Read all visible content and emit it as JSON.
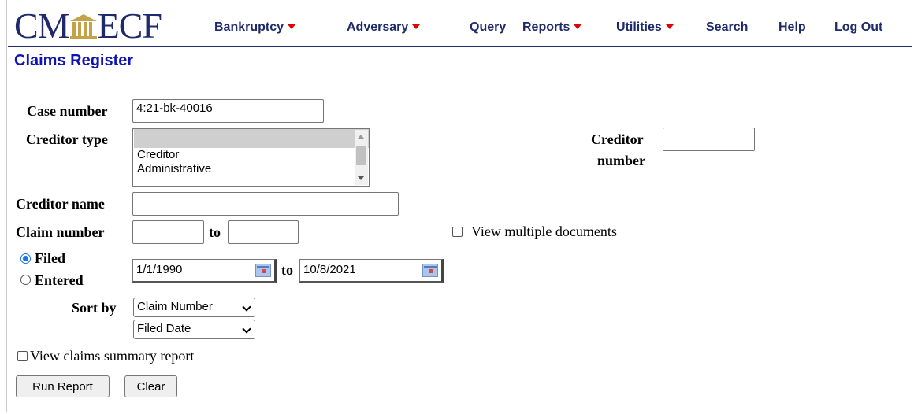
{
  "header": {
    "logo_left": "CM",
    "logo_right": "ECF",
    "nav": [
      {
        "label": "Bankruptcy",
        "dropdown": true
      },
      {
        "label": "Adversary",
        "dropdown": true
      },
      {
        "label": "Query",
        "dropdown": false
      },
      {
        "label": "Reports",
        "dropdown": true
      },
      {
        "label": "Utilities",
        "dropdown": true
      },
      {
        "label": "Search",
        "dropdown": false
      },
      {
        "label": "Help",
        "dropdown": false
      },
      {
        "label": "Log Out",
        "dropdown": false
      }
    ]
  },
  "page_title": "Claims Register",
  "form": {
    "case_number": {
      "label": "Case number",
      "value": "4:21-bk-40016"
    },
    "creditor_type": {
      "label": "Creditor type",
      "options": [
        "",
        "Creditor",
        "Administrative"
      ]
    },
    "creditor_number": {
      "label_line1": "Creditor",
      "label_line2": "number",
      "value": ""
    },
    "creditor_name": {
      "label": "Creditor name",
      "value": ""
    },
    "claim_number": {
      "label": "Claim number",
      "to_label": "to",
      "from_value": "",
      "to_value": ""
    },
    "view_multiple": {
      "label": "View multiple documents",
      "checked": false
    },
    "date_type": {
      "filed_label": "Filed",
      "entered_label": "Entered",
      "selected": "Filed"
    },
    "date_range": {
      "from": "1/1/1990",
      "to_label": "to",
      "to": "10/8/2021"
    },
    "sort_by": {
      "label": "Sort by",
      "primary": "Claim Number",
      "secondary": "Filed Date"
    },
    "summary_report": {
      "label": "View claims summary report",
      "checked": false
    }
  },
  "buttons": {
    "run": "Run Report",
    "clear": "Clear"
  },
  "colors": {
    "brand_navy": "#1f2a6b",
    "title_blue": "#0f14b4",
    "caret_red": "#e00000",
    "logo_gold": "#c4a24a"
  }
}
